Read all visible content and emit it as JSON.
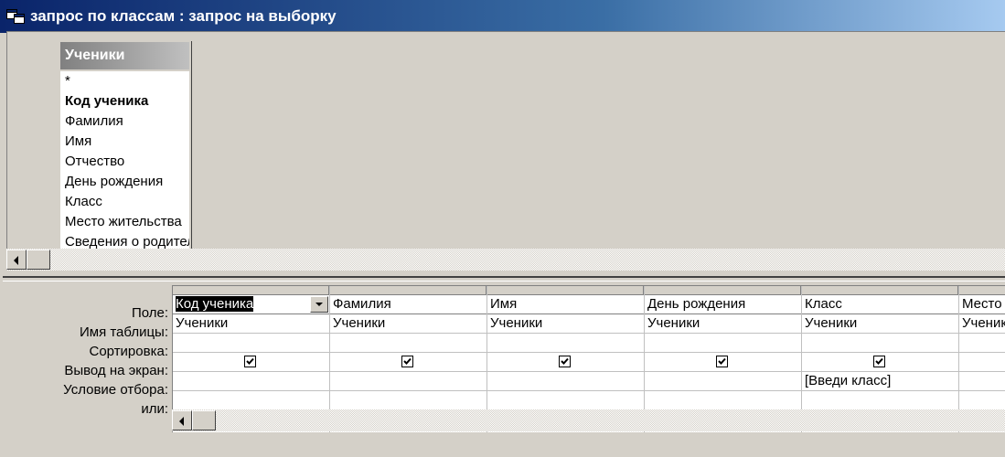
{
  "window": {
    "title": "запрос по классам : запрос на выборку"
  },
  "field_list": {
    "title": "Ученики",
    "items": [
      {
        "label": "*",
        "bold": false
      },
      {
        "label": "Код ученика",
        "bold": true
      },
      {
        "label": "Фамилия",
        "bold": false
      },
      {
        "label": "Имя",
        "bold": false
      },
      {
        "label": "Отчество",
        "bold": false
      },
      {
        "label": "День рождения",
        "bold": false
      },
      {
        "label": "Класс",
        "bold": false
      },
      {
        "label": "Место жительства",
        "bold": false
      },
      {
        "label": "Сведения о родителях",
        "bold": false
      }
    ]
  },
  "grid": {
    "row_labels": {
      "field": "Поле:",
      "table": "Имя таблицы:",
      "sort": "Сортировка:",
      "show": "Вывод на экран:",
      "criteria": "Условие отбора:",
      "or": "или:"
    },
    "columns": [
      {
        "field": "Код ученика",
        "table": "Ученики",
        "sort": "",
        "show": true,
        "criteria": "",
        "or": ""
      },
      {
        "field": "Фамилия",
        "table": "Ученики",
        "sort": "",
        "show": true,
        "criteria": "",
        "or": ""
      },
      {
        "field": "Имя",
        "table": "Ученики",
        "sort": "",
        "show": true,
        "criteria": "",
        "or": ""
      },
      {
        "field": "День рождения",
        "table": "Ученики",
        "sort": "",
        "show": true,
        "criteria": "",
        "or": ""
      },
      {
        "field": "Класс",
        "table": "Ученики",
        "sort": "",
        "show": true,
        "criteria": "[Введи класс]",
        "or": ""
      },
      {
        "field": "Место",
        "table": "Ученики",
        "sort": "",
        "show": false,
        "criteria": "",
        "or": ""
      }
    ],
    "selected_column": 0
  },
  "icons": {
    "window_icon": "query-icon",
    "scroll_left": "arrow-left-icon",
    "dropdown": "chevron-down-icon",
    "checkbox": "checkmark-icon"
  }
}
